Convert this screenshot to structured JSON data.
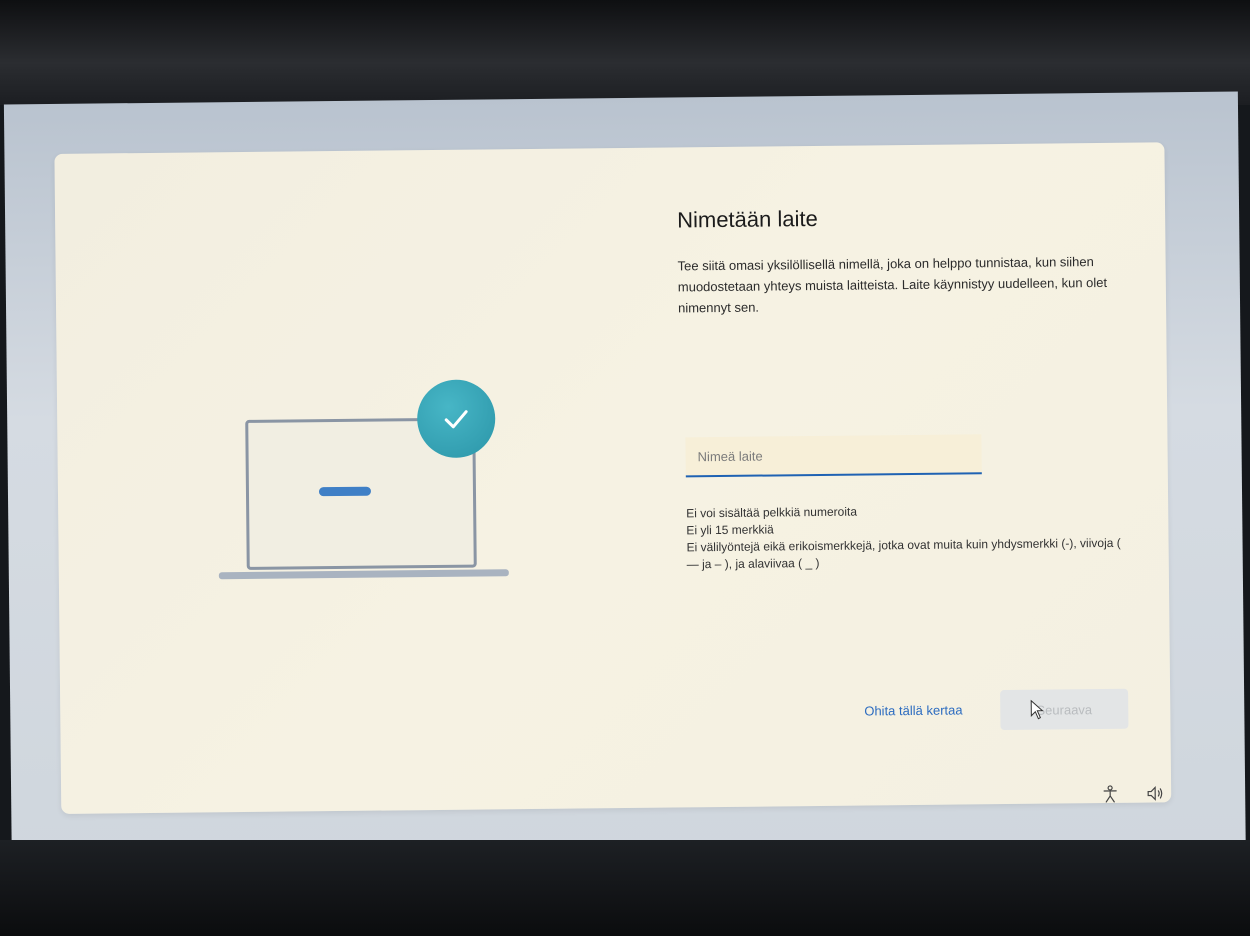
{
  "page": {
    "title": "Nimetään laite",
    "description": "Tee siitä omasi yksilöllisellä nimellä, joka on helppo tunnistaa, kun siihen muodostetaan yhteys muista laitteista. Laite käynnistyy uudelleen, kun olet nimennyt sen."
  },
  "input": {
    "value": "",
    "placeholder": "Nimeä laite"
  },
  "rules": [
    "Ei voi sisältää pelkkiä numeroita",
    "Ei yli 15 merkkiä",
    "Ei välilyöntejä eikä erikoismerkkejä, jotka ovat muita kuin yhdysmerkki (-), viivoja ( — ja – ), ja alaviivaa ( _ )"
  ],
  "actions": {
    "skip_label": "Ohita tällä kertaa",
    "next_label": "Seuraava"
  },
  "icons": {
    "illustration_check": "check-icon",
    "tray_accessibility": "accessibility-icon",
    "tray_volume": "volume-icon"
  },
  "colors": {
    "accent": "#1f62b3",
    "check_circle": "#2b95a8",
    "card_bg": "#f4f0e1"
  }
}
